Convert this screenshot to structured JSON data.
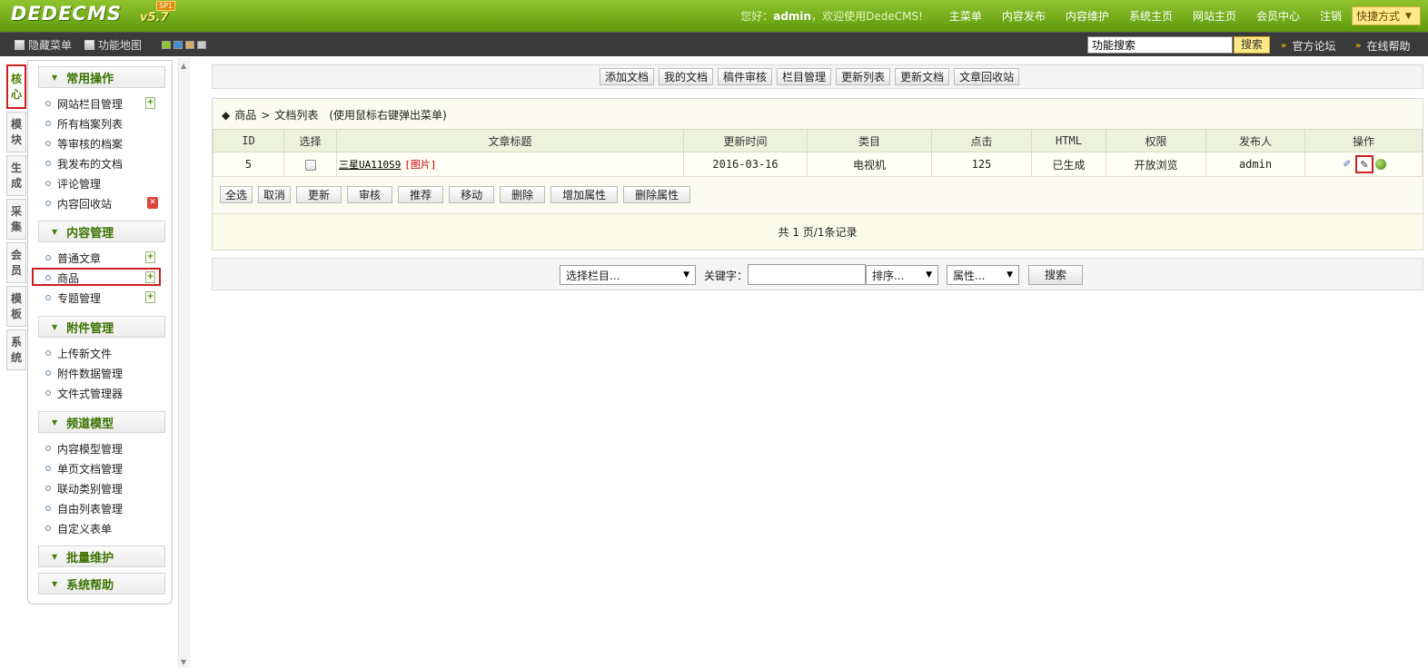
{
  "header": {
    "logo_text": "DEDECMS",
    "version": "v5.7",
    "badge": "SP1",
    "welcome_prefix": "您好：",
    "username": "admin",
    "welcome_suffix": "，欢迎使用DedeCMS!",
    "nav": [
      "主菜单",
      "内容发布",
      "内容维护",
      "系统主页",
      "网站主页",
      "会员中心",
      "注销"
    ],
    "quick_label": "快捷方式"
  },
  "subbar": {
    "hide_menu": "隐藏菜单",
    "site_map": "功能地图",
    "swatch_colors": [
      "#8fc42e",
      "#3a8fd0",
      "#d4b070",
      "#c8c8c8"
    ],
    "search_value": "功能搜索",
    "search_button": "搜索",
    "forum": "官方论坛",
    "help": "在线帮助"
  },
  "vtabs": [
    {
      "label": "核心",
      "active": true
    },
    {
      "label": "模块",
      "active": false
    },
    {
      "label": "生成",
      "active": false
    },
    {
      "label": "采集",
      "active": false
    },
    {
      "label": "会员",
      "active": false
    },
    {
      "label": "模板",
      "active": false
    },
    {
      "label": "系统",
      "active": false
    }
  ],
  "menu": {
    "groups": [
      {
        "title": "常用操作",
        "items": [
          "网站栏目管理",
          "所有档案列表",
          "等审核的档案",
          "我发布的文档",
          "评论管理",
          "内容回收站"
        ]
      },
      {
        "title": "内容管理",
        "items": [
          "普通文章",
          "商品",
          "专题管理"
        ]
      },
      {
        "title": "附件管理",
        "items": [
          "上传新文件",
          "附件数据管理",
          "文件式管理器"
        ]
      },
      {
        "title": "频道模型",
        "items": [
          "内容模型管理",
          "单页文档管理",
          "联动类别管理",
          "自由列表管理",
          "自定义表单"
        ]
      },
      {
        "title": "批量维护",
        "items": []
      },
      {
        "title": "系统帮助",
        "items": []
      }
    ]
  },
  "toolbar": {
    "buttons": [
      "添加文档",
      "我的文档",
      "稿件审核",
      "栏目管理",
      "更新列表",
      "更新文档",
      "文章回收站"
    ]
  },
  "list": {
    "crumb_channel": "商品",
    "crumb_sep": ">",
    "crumb_page": "文档列表",
    "hint": "(使用鼠标右键弹出菜单)",
    "columns": [
      "ID",
      "选择",
      "文章标题",
      "更新时间",
      "类目",
      "点击",
      "HTML",
      "权限",
      "发布人",
      "操作"
    ],
    "rows": [
      {
        "id": "5",
        "title": "三星UA110S9",
        "flag": "图片",
        "time": "2016-03-16",
        "category": "电视机",
        "clicks": "125",
        "html": "已生成",
        "perm": "开放浏览",
        "author": "admin"
      }
    ],
    "actions": [
      "全选",
      "取消",
      "更新",
      "审核",
      "推荐",
      "移动",
      "删除",
      "增加属性",
      "删除属性"
    ],
    "pager": "共 1 页/1条记录"
  },
  "search": {
    "column_select": "选择栏目...",
    "keyword_label": "关键字：",
    "keyword_value": "",
    "order_select": "排序...",
    "attr_select": "属性...",
    "button": "搜索"
  }
}
